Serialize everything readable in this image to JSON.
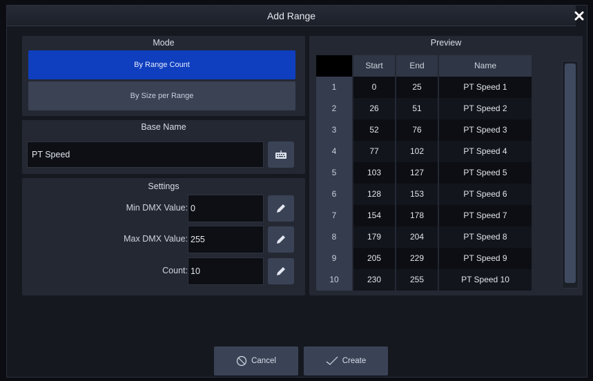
{
  "dialog": {
    "title": "Add Range",
    "close_label": "✕"
  },
  "mode": {
    "title": "Mode",
    "options": [
      {
        "label": "By Range Count",
        "selected": true
      },
      {
        "label": "By Size per Range",
        "selected": false
      }
    ]
  },
  "base_name": {
    "title": "Base Name",
    "value": "PT Speed",
    "keyboard_icon": "keyboard-icon"
  },
  "settings": {
    "title": "Settings",
    "min": {
      "label": "Min DMX Value:",
      "value": "0"
    },
    "max": {
      "label": "Max DMX Value:",
      "value": "255"
    },
    "count": {
      "label": "Count:",
      "value": "10"
    },
    "edit_icon": "pencil-icon"
  },
  "preview": {
    "title": "Preview",
    "columns": [
      "",
      "Start",
      "End",
      "Name"
    ],
    "rows": [
      [
        "1",
        "0",
        "25",
        "PT Speed 1"
      ],
      [
        "2",
        "26",
        "51",
        "PT Speed 2"
      ],
      [
        "3",
        "52",
        "76",
        "PT Speed 3"
      ],
      [
        "4",
        "77",
        "102",
        "PT Speed 4"
      ],
      [
        "5",
        "103",
        "127",
        "PT Speed 5"
      ],
      [
        "6",
        "128",
        "153",
        "PT Speed 6"
      ],
      [
        "7",
        "154",
        "178",
        "PT Speed 7"
      ],
      [
        "8",
        "179",
        "204",
        "PT Speed 8"
      ],
      [
        "9",
        "205",
        "229",
        "PT Speed 9"
      ],
      [
        "10",
        "230",
        "255",
        "PT Speed 10"
      ]
    ]
  },
  "buttons": {
    "cancel": {
      "label": "Cancel",
      "icon": "cancel-circle-icon"
    },
    "create": {
      "label": "Create",
      "icon": "checkmark-icon"
    }
  },
  "colors": {
    "accent": "#0f3fbf",
    "panel": "#242833",
    "button": "#3a4356"
  }
}
